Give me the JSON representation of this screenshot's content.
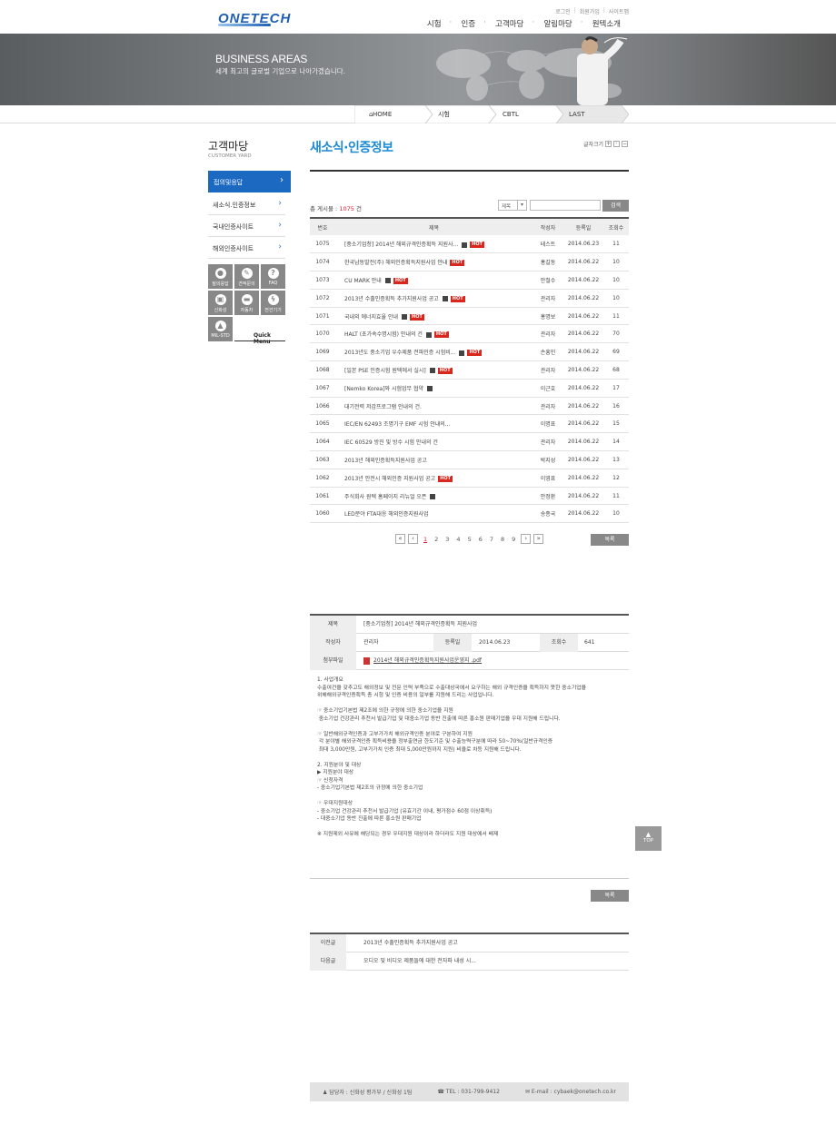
{
  "header": {
    "logo": "ONETECH",
    "util": [
      "로그인",
      "회원가입",
      "사이트맵"
    ],
    "gnb": [
      "시험",
      "인증",
      "고객마당",
      "알림마당",
      "원텍소개"
    ]
  },
  "hero": {
    "title": "BUSINESS AREAS",
    "subtitle": "세계 최고의 글로벌 기업으로 나아가겠습니다."
  },
  "breadcrumb": [
    "HOME",
    "시험",
    "CBTL",
    "LAST"
  ],
  "sidebar": {
    "title": "고객마당",
    "subtitle": "CUSTOMER YARD",
    "items": [
      "접의및응답",
      "새소식.인증정보",
      "국내인증사이트",
      "해외인증사이트"
    ],
    "quick": {
      "cells": [
        "질의응답",
        "견적문의",
        "FAQ",
        "신화성",
        "자동차",
        "전건기기",
        "MIL-STD"
      ],
      "label": "Quick Menu"
    }
  },
  "content": {
    "title": "새소식·인증정보",
    "font_size_label": "글자크기",
    "total_label": "총 게시물 :",
    "total_count": "1075",
    "total_unit": "건",
    "search_select": "제목",
    "search_button": "검색",
    "columns": [
      "번호",
      "제목",
      "작성자",
      "등록일",
      "조회수"
    ],
    "rows": [
      {
        "no": "1075",
        "title": "[중소기업청] 2014년 해외규격인증획득 지원사...",
        "file": true,
        "hot": true,
        "author": "테스트",
        "date": "2014.06.23",
        "views": "11"
      },
      {
        "no": "1074",
        "title": "한국남동발전(주) 해외인증획득지원사업 안내",
        "file": false,
        "hot": true,
        "author": "홍길동",
        "date": "2014.06.22",
        "views": "10"
      },
      {
        "no": "1073",
        "title": "CU MARK 안내",
        "file": true,
        "hot": true,
        "author": "안철수",
        "date": "2014.06.22",
        "views": "10"
      },
      {
        "no": "1072",
        "title": "2013년 수출인증획득 추가지원사업 공고",
        "file": true,
        "hot": true,
        "author": "관리자",
        "date": "2014.06.22",
        "views": "10"
      },
      {
        "no": "1071",
        "title": "국내외 에너지효율 안내",
        "file": true,
        "hot": true,
        "author": "홍명보",
        "date": "2014.06.22",
        "views": "11"
      },
      {
        "no": "1070",
        "title": "HALT (초가속수명시험) 안내의 건",
        "file": true,
        "hot": true,
        "author": "관리자",
        "date": "2014.06.22",
        "views": "70"
      },
      {
        "no": "1069",
        "title": "2013년도 중소기업 우수제품 전파인증 시험비...",
        "file": true,
        "hot": true,
        "author": "손흥민",
        "date": "2014.06.22",
        "views": "69"
      },
      {
        "no": "1068",
        "title": "[일본 PSE 인증시험 원텍에서 실시]",
        "file": true,
        "hot": true,
        "author": "관리자",
        "date": "2014.06.22",
        "views": "68"
      },
      {
        "no": "1067",
        "title": "[Nemko Korea]와 시험업무 협약",
        "file": true,
        "hot": false,
        "author": "이근호",
        "date": "2014.06.22",
        "views": "17"
      },
      {
        "no": "1066",
        "title": "대기전력 저감프로그램 안내의 건.",
        "file": false,
        "hot": false,
        "author": "관리자",
        "date": "2014.06.22",
        "views": "16"
      },
      {
        "no": "1065",
        "title": "IEC/EN 62493 조명기구 EMF 시험 안내의...",
        "file": false,
        "hot": false,
        "author": "이명표",
        "date": "2014.06.22",
        "views": "15"
      },
      {
        "no": "1064",
        "title": "IEC 60529 방진 및 방수 시험 안내의 건",
        "file": false,
        "hot": false,
        "author": "관리자",
        "date": "2014.06.22",
        "views": "14"
      },
      {
        "no": "1063",
        "title": "2013년 해외인증획득지원사업 공고",
        "file": false,
        "hot": false,
        "author": "박지성",
        "date": "2014.06.22",
        "views": "13"
      },
      {
        "no": "1062",
        "title": "2013년 안전시 해외인증 지원사업 공고",
        "file": false,
        "hot": true,
        "author": "이영표",
        "date": "2014.06.22",
        "views": "12"
      },
      {
        "no": "1061",
        "title": "주식회사 원텍 홈페이지 리뉴얼 오픈",
        "file": true,
        "hot": false,
        "author": "안정환",
        "date": "2014.06.22",
        "views": "11"
      },
      {
        "no": "1060",
        "title": "LED분야 FTA대응 해외인증지원사업",
        "file": false,
        "hot": false,
        "author": "송종국",
        "date": "2014.06.22",
        "views": "10"
      }
    ],
    "pages": [
      "1",
      "2",
      "3",
      "4",
      "5",
      "6",
      "7",
      "8",
      "9"
    ],
    "current_page": "1",
    "list_button": "목록"
  },
  "view": {
    "title_label": "제목",
    "title": "[중소기업청] 2014년 해외규격인증획득 지원사업",
    "author_label": "작성자",
    "author": "관리자",
    "date_label": "등록일",
    "date": "2014.06.23",
    "views_label": "조회수",
    "views": "641",
    "file_label": "첨부파일",
    "file": "2014년 해외규격인증획득지원사업운영지 .pdf",
    "body": [
      "1. 사업개요",
      "수출여건을 갖추고도 해외정보 및 전문 인력 부족으로 수출대상국에서 요구하는 해외 규격인증을 획득하지 못한 중소기업을",
      "위해해외규격인증획득 총 시험 및 인증 비용의 일부를 지원해 드리는 사업입니다.",
      "",
      "☞ 중소기업기본법 제2조에 의한 규정에 의한 중소기업을 지원",
      " 중소기업 건강관리 추천서 발급기업 및 대중소기업 동반 진출에 따른 홍소원 판매기업을 우대 지원해 드립니다.",
      "",
      "☞ 일반해외규격인증과 고부가가치 해외규격인증 분야로 구분하여 지원",
      " 각 분야별 해외규격인증 획득비용을 정부출연금 한도기준 및 수출능력구분에 따라 50~70%(일반규격인증",
      " 최대 3,000만원, 고부가가치 인증 최대 5,000만원까지 지원) 비율로 차등 지원해 드립니다.",
      "",
      "2. 지원분야 및 대상",
      "▶ 지원분야 대상",
      "☞ 신청자격",
      "- 중소기업기본법 제2조의 규정에 의한 중소기업",
      "",
      "☞ 우대지원대상",
      "- 중소기업 건강관리 추천서 발급기업 (유효기간 이내, 평가점수 60점 이상취득)",
      "- 대중소기업 동반 진출에 따른 홍소원 판매기업",
      "",
      "※ 지원제외 사유에 해당되는 경우 우대지원 대상이라 하더라도 지원 대상에서 배제"
    ],
    "list_button": "목록"
  },
  "prevnext": {
    "prev_label": "이전글",
    "prev": "2013년 수출인증획득 추가지원사업 공고",
    "next_label": "다음글",
    "next": "오디오 및 비디오 제품들에 대한 전자파 내성 시..."
  },
  "footer": {
    "contact": "담당자 : 신화성 평가부 / 신화성 1팀",
    "tel": "TEL : 031-799-9412",
    "email": "E-mail : cybaek@onetech.co.kr"
  },
  "top_button": "TOP"
}
